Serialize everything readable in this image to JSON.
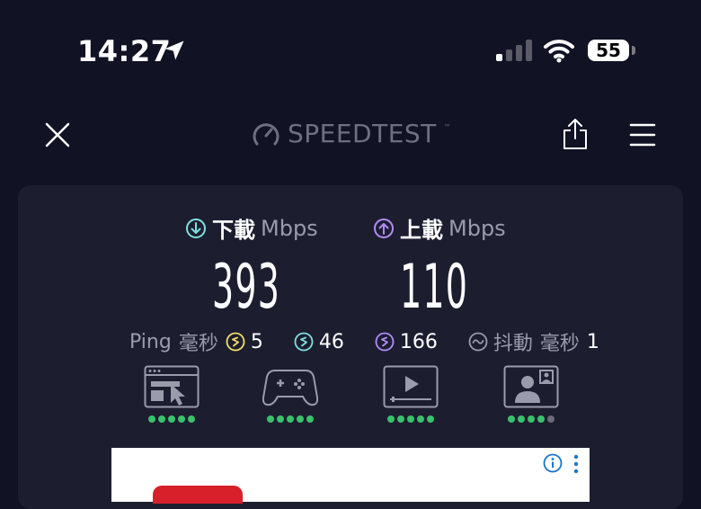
{
  "status_bar": {
    "time": "14:27",
    "battery": "55",
    "icons": [
      "location-arrow-icon",
      "cellular-signal-icon",
      "wifi-icon",
      "battery-icon"
    ]
  },
  "nav": {
    "brand": "SPEEDTEST",
    "icons": [
      "close-icon",
      "speedometer-icon",
      "share-icon",
      "menu-icon"
    ]
  },
  "download": {
    "label": "下載",
    "unit": "Mbps",
    "value": "393",
    "accent": "#7fe0e0"
  },
  "upload": {
    "label": "上載",
    "unit": "Mbps",
    "value": "110",
    "accent": "#b38cf5"
  },
  "ping": {
    "label": "Ping",
    "unit": "毫秒",
    "idle": "5",
    "download": "46",
    "upload": "166",
    "jitter_label": "抖動",
    "jitter_unit": "毫秒",
    "jitter": "1",
    "colors": {
      "idle": "#f4de6c",
      "download": "#7fe0e0",
      "upload": "#b38cf5"
    }
  },
  "quality": [
    {
      "name": "web-browsing",
      "icon": "browser-cursor-icon",
      "rating": 5,
      "max": 5
    },
    {
      "name": "gaming",
      "icon": "gamepad-icon",
      "rating": 5,
      "max": 5
    },
    {
      "name": "video-streaming",
      "icon": "video-player-icon",
      "rating": 5,
      "max": 5
    },
    {
      "name": "video-chat",
      "icon": "video-call-icon",
      "rating": 4,
      "max": 5
    }
  ],
  "colors": {
    "background": "#111224",
    "card": "#1c1e30",
    "good": "#39c26b"
  }
}
